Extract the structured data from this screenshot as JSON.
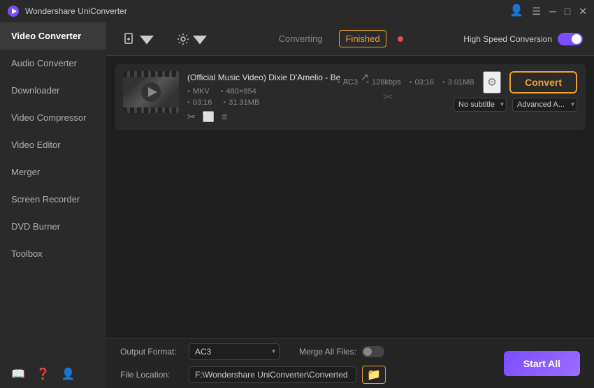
{
  "app": {
    "title": "Wondershare UniConverter",
    "logo_char": "🎬"
  },
  "titlebar": {
    "menu_icon": "☰",
    "minimize": "─",
    "maximize": "□",
    "close": "✕"
  },
  "sidebar": {
    "active_item": "Video Converter",
    "items": [
      {
        "label": "Audio Converter"
      },
      {
        "label": "Downloader"
      },
      {
        "label": "Video Compressor"
      },
      {
        "label": "Video Editor"
      },
      {
        "label": "Merger"
      },
      {
        "label": "Screen Recorder"
      },
      {
        "label": "DVD Burner"
      },
      {
        "label": "Toolbox"
      }
    ]
  },
  "toolbar": {
    "converting_label": "Converting",
    "finished_label": "Finished",
    "high_speed_label": "High Speed Conversion"
  },
  "file": {
    "title": "(Official Music Video) Dixie D'Amelio - Be Happ....",
    "source": {
      "format": "MKV",
      "resolution": "480×854",
      "duration": "03:16",
      "size": "31.31MB"
    },
    "output": {
      "codec": "AC3",
      "bitrate": "128kbps",
      "duration": "03:16",
      "size": "3.01MB"
    },
    "subtitle_placeholder": "No subtitle",
    "advanced_label": "Advanced A...",
    "convert_btn": "Convert"
  },
  "bottom_bar": {
    "output_format_label": "Output Format:",
    "output_format_value": "AC3",
    "merge_all_label": "Merge All Files:",
    "file_location_label": "File Location:",
    "file_location_value": "F:\\Wondershare UniConverter\\Converted",
    "start_all_btn": "Start All"
  }
}
